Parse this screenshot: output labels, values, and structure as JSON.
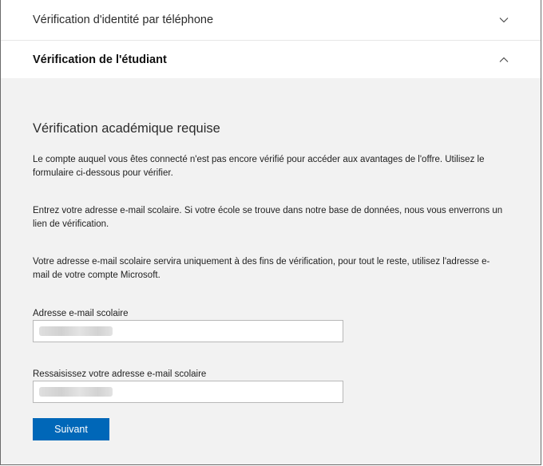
{
  "accordion": {
    "phone_title": "Vérification d'identité par téléphone",
    "student_title": "Vérification de l'étudiant"
  },
  "section": {
    "heading": "Vérification académique requise",
    "para1": "Le compte auquel vous êtes connecté n'est pas encore vérifié pour accéder aux avantages de l'offre. Utilisez le formulaire ci-dessous pour vérifier.",
    "para2": "Entrez votre adresse e-mail scolaire. Si votre école se trouve dans notre base de données, nous vous enverrons un lien de vérification.",
    "para3": "Votre adresse e-mail scolaire servira uniquement à des fins de vérification, pour tout le reste, utilisez l'adresse e-mail de votre compte Microsoft."
  },
  "form": {
    "email_label": "Adresse e-mail scolaire",
    "email_value": "",
    "confirm_label": "Ressaisissez votre adresse e-mail scolaire",
    "confirm_value": "",
    "submit_label": "Suivant"
  },
  "icons": {
    "phone_chevron": "chevron-down-icon",
    "student_chevron": "chevron-up-icon"
  },
  "colors": {
    "accent": "#0067b8",
    "panel_bg": "#f2f2f2"
  }
}
